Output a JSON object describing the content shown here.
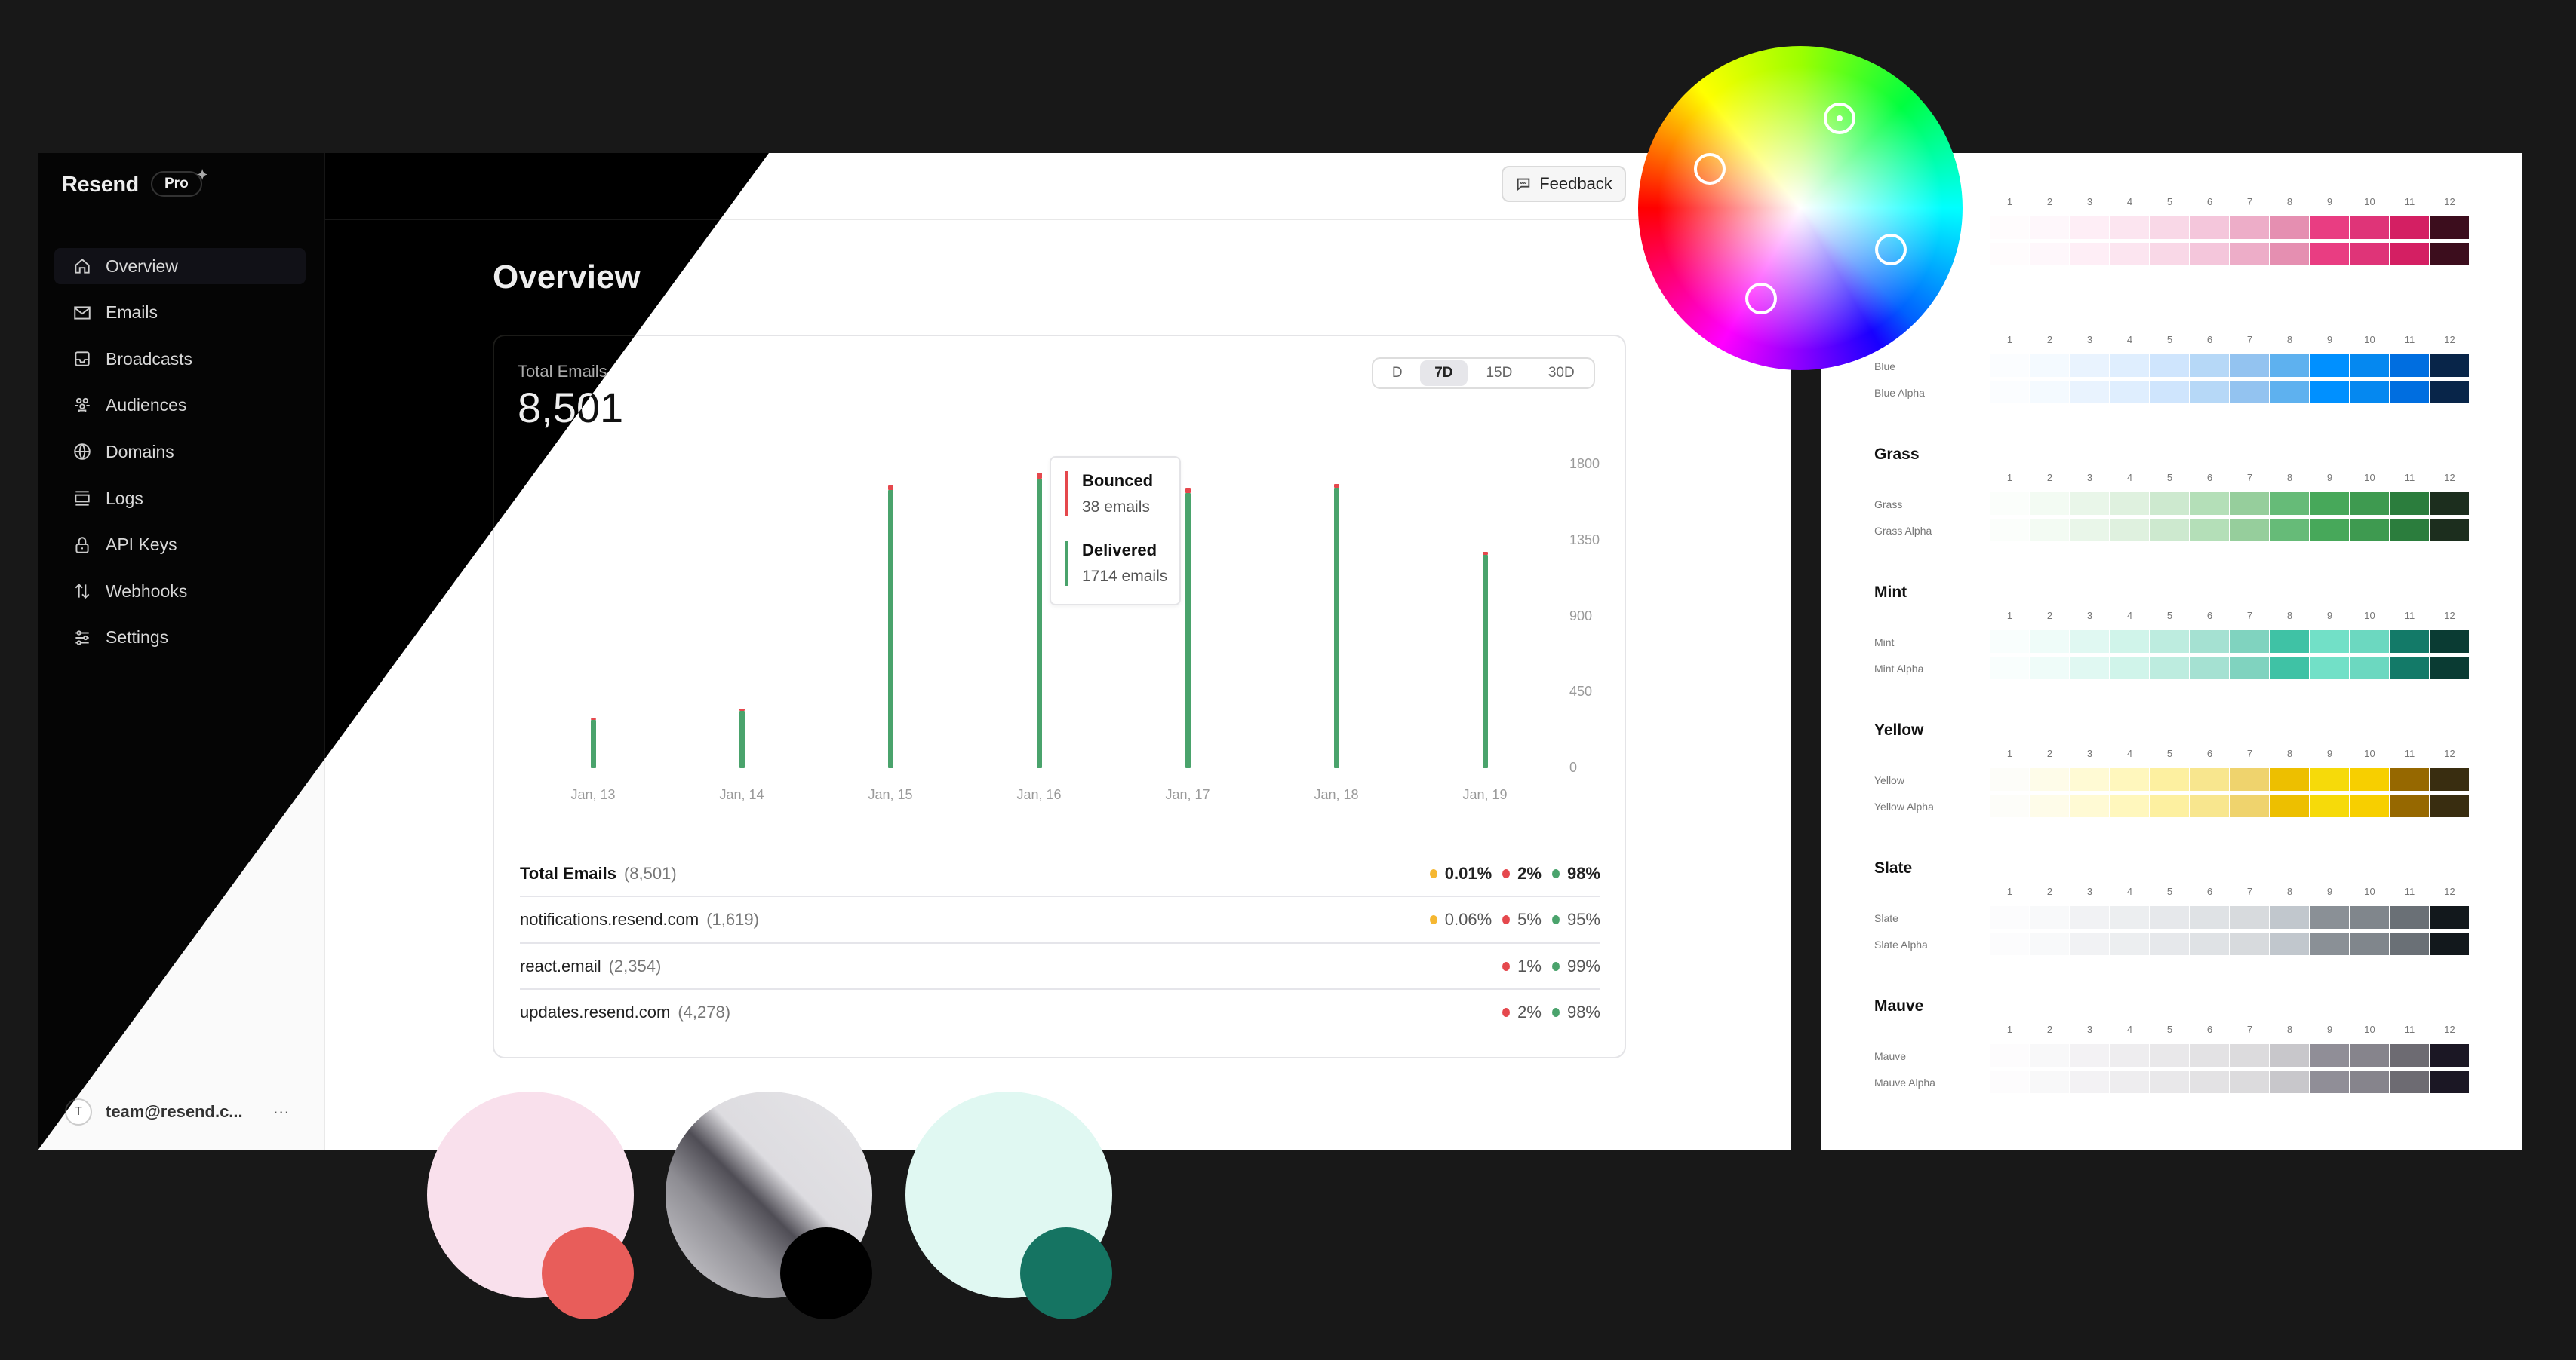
{
  "sidebar": {
    "brand": "Resend",
    "plan_badge": "Pro",
    "items": [
      {
        "label": "Overview",
        "icon": "home-icon",
        "active": true
      },
      {
        "label": "Emails",
        "icon": "mail-icon"
      },
      {
        "label": "Broadcasts",
        "icon": "inbox-icon"
      },
      {
        "label": "Audiences",
        "icon": "users-icon"
      },
      {
        "label": "Domains",
        "icon": "globe-icon"
      },
      {
        "label": "Logs",
        "icon": "logs-icon"
      },
      {
        "label": "API Keys",
        "icon": "lock-icon"
      },
      {
        "label": "Webhooks",
        "icon": "arrows-icon"
      },
      {
        "label": "Settings",
        "icon": "sliders-icon"
      }
    ],
    "user": {
      "initial": "T",
      "email": "team@resend.c...",
      "more": "···"
    }
  },
  "header": {
    "feedback_label": "Feedback"
  },
  "main": {
    "title": "Overview",
    "total_label": "Total Emails",
    "total_value": "8,501",
    "ranges": [
      "D",
      "7D",
      "15D",
      "30D"
    ],
    "active_range": "7D",
    "tooltip": {
      "bounced_label": "Bounced",
      "bounced_value": "38 emails",
      "delivered_label": "Delivered",
      "delivered_value": "1714 emails"
    },
    "table": [
      {
        "name": "Total Emails",
        "count": "(8,501)",
        "bold": true,
        "complained": "0.01%",
        "bounced": "2%",
        "delivered": "98%"
      },
      {
        "name": "notifications.resend.com",
        "count": "(1,619)",
        "complained": "0.06%",
        "bounced": "5%",
        "delivered": "95%"
      },
      {
        "name": "react.email",
        "count": "(2,354)",
        "bounced": "1%",
        "delivered": "99%"
      },
      {
        "name": "updates.resend.com",
        "count": "(4,278)",
        "bounced": "2%",
        "delivered": "98%"
      }
    ]
  },
  "colors": {
    "delivered": "#4aa36c",
    "bounced": "#e5484d",
    "complained": "#f5b731"
  },
  "chart_data": {
    "type": "bar",
    "stacked": true,
    "categories": [
      "Jan, 13",
      "Jan, 14",
      "Jan, 15",
      "Jan, 16",
      "Jan, 17",
      "Jan, 18",
      "Jan, 19"
    ],
    "series": [
      {
        "name": "Delivered",
        "values": [
          285,
          340,
          1650,
          1714,
          1630,
          1660,
          1262
        ]
      },
      {
        "name": "Bounced",
        "values": [
          10,
          12,
          25,
          38,
          30,
          25,
          22
        ]
      }
    ],
    "yticks": [
      0,
      450,
      900,
      1350,
      1800
    ],
    "ylim": [
      0,
      1800
    ],
    "y_axis_side": "right",
    "grid": false
  },
  "palette": {
    "columns": [
      "1",
      "2",
      "3",
      "4",
      "5",
      "6",
      "7",
      "8",
      "9",
      "10",
      "11",
      "12"
    ],
    "sections": [
      {
        "title": null,
        "rows": [
          null,
          null
        ],
        "colors": [
          "#fffcfd",
          "#fef7fb",
          "#feeef6",
          "#fce5f0",
          "#f9d8e7",
          "#f4c6db",
          "#edadc8",
          "#e58fb1",
          "#e93d82",
          "#df3478",
          "#d41f63",
          "#3c0d1d"
        ]
      },
      {
        "title": null,
        "rows": [
          "Blue",
          "Blue Alpha"
        ],
        "colors": [
          "#fbfdff",
          "#f4faff",
          "#e9f3fe",
          "#dfeefe",
          "#cfe5fd",
          "#b6d8f7",
          "#93c3f0",
          "#5eb1ef",
          "#0090ff",
          "#0588f0",
          "#006ee0",
          "#082549"
        ]
      },
      {
        "title": "Grass",
        "rows": [
          "Grass",
          "Grass Alpha"
        ],
        "colors": [
          "#fbfefb",
          "#f3fbf3",
          "#e9f6e9",
          "#dff1df",
          "#cde9cf",
          "#b4dfb8",
          "#96ce9c",
          "#66bb78",
          "#47a85a",
          "#3e9a50",
          "#2b7d3d",
          "#1c2e1e"
        ]
      },
      {
        "title": "Mint",
        "rows": [
          "Mint",
          "Mint Alpha"
        ],
        "colors": [
          "#f9fefd",
          "#effcf9",
          "#e0f8f2",
          "#d0f4ea",
          "#bdecdf",
          "#a5e1d2",
          "#80d3bf",
          "#3fc2a5",
          "#72e0c7",
          "#6cd8c0",
          "#137a68",
          "#0a3b33"
        ]
      },
      {
        "title": "Yellow",
        "rows": [
          "Yellow",
          "Yellow Alpha"
        ],
        "colors": [
          "#fdfdf9",
          "#fefce9",
          "#fffad4",
          "#fff7bd",
          "#fdf0a0",
          "#f8e68e",
          "#efd36d",
          "#edbf00",
          "#f6da0a",
          "#f7cf00",
          "#966800",
          "#392d10"
        ]
      },
      {
        "title": "Slate",
        "rows": [
          "Slate",
          "Slate Alpha"
        ],
        "colors": [
          "#fcfcfd",
          "#f8f9fa",
          "#f1f2f4",
          "#eceef0",
          "#e6e8eb",
          "#dfe2e5",
          "#d7dadd",
          "#c1c7cd",
          "#8a9096",
          "#80868c",
          "#6a7076",
          "#12181c"
        ]
      },
      {
        "title": "Mauve",
        "rows": [
          "Mauve",
          "Mauve Alpha"
        ],
        "colors": [
          "#fdfcfd",
          "#f8f8f9",
          "#f3f2f4",
          "#eeedef",
          "#e9e8ea",
          "#e3e2e4",
          "#dcdbdd",
          "#c8c7cb",
          "#908e97",
          "#86848c",
          "#6d6b72",
          "#1b1724"
        ]
      }
    ]
  },
  "decor": {
    "swatch_pairs": [
      {
        "large": "#f9e0ec",
        "small": "#e85d5a"
      },
      {
        "large": "gradient-gray",
        "small": "#000000"
      },
      {
        "large": "#e0f8f2",
        "small": "#157462"
      }
    ]
  }
}
